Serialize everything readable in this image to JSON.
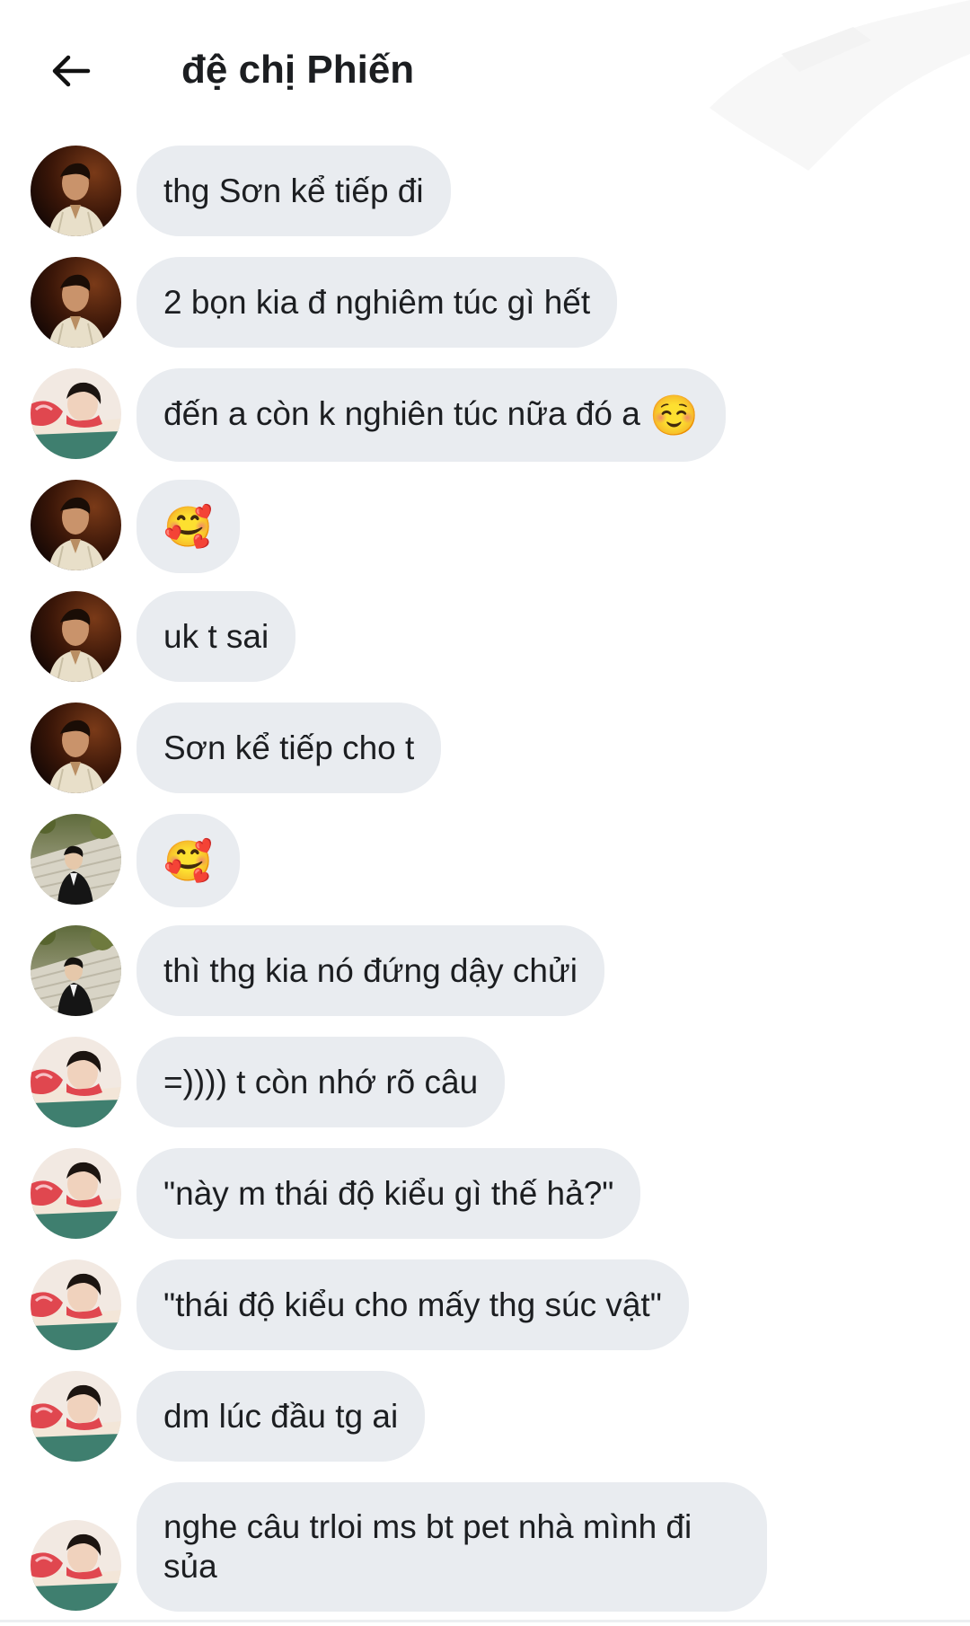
{
  "header": {
    "back_icon": "arrow-left-icon",
    "title": "đệ chị Phiến"
  },
  "messages": [
    {
      "sender": "avatar-a",
      "text": "thg Sơn kể tiếp đi"
    },
    {
      "sender": "avatar-a",
      "text": "2 bọn kia đ nghiêm túc gì hết"
    },
    {
      "sender": "avatar-b",
      "text": "đến a còn k nghiên túc nữa đó a",
      "emoji": "☺️"
    },
    {
      "sender": "avatar-a",
      "text": "",
      "emoji": "🥰"
    },
    {
      "sender": "avatar-a",
      "text": "uk t sai"
    },
    {
      "sender": "avatar-a",
      "text": "Sơn kể tiếp cho t"
    },
    {
      "sender": "avatar-c",
      "text": "",
      "emoji": "🥰"
    },
    {
      "sender": "avatar-c",
      "text": "thì thg kia nó đứng dậy chửi"
    },
    {
      "sender": "avatar-b",
      "text": "=)))) t còn nhớ rõ câu"
    },
    {
      "sender": "avatar-b",
      "text": "\"này m thái độ kiểu gì thế hả?\""
    },
    {
      "sender": "avatar-b",
      "text": "\"thái độ kiểu cho mấy thg súc vật\""
    },
    {
      "sender": "avatar-b",
      "text": "dm lúc đầu tg ai"
    },
    {
      "sender": "avatar-b",
      "text": "nghe câu trloi ms bt pet nhà mình đi sủa"
    }
  ],
  "colors": {
    "bubble": "#e9ecf0",
    "text": "#1c1e21",
    "background": "#ffffff"
  }
}
